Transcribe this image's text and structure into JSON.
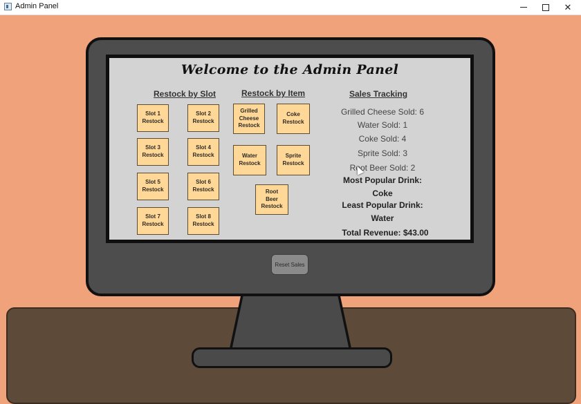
{
  "window": {
    "title": "Admin Panel",
    "controls": {
      "minimize": "minimize",
      "maximize": "maximize",
      "close": "✕"
    }
  },
  "panel": {
    "title": "Welcome to the Admin Panel",
    "restock_by_slot": {
      "heading": "Restock by Slot",
      "buttons": [
        "Slot 1\nRestock",
        "Slot 2\nRestock",
        "Slot 3\nRestock",
        "Slot 4\nRestock",
        "Slot 5\nRestock",
        "Slot 6\nRestock",
        "Slot 7\nRestock",
        "Slot 8\nRestock"
      ]
    },
    "restock_by_item": {
      "heading": "Restock by Item",
      "buttons": [
        "Grilled\nCheese\nRestock",
        "Coke\nRestock",
        "Water\nRestock",
        "Sprite\nRestock",
        "Root\nBeer\nRestock"
      ]
    },
    "sales_tracking": {
      "heading": "Sales Tracking",
      "lines": [
        "Grilled Cheese Sold: 6",
        "Water Sold: 1",
        "Coke Sold: 4",
        "Sprite Sold: 3",
        "Root Beer Sold: 2"
      ],
      "most_popular_label": "Most Popular Drink:",
      "most_popular_value": "Coke",
      "least_popular_label": "Least Popular Drink:",
      "least_popular_value": "Water",
      "total_revenue": "Total Revenue: $43.00"
    }
  },
  "reset_button": "Reset Sales",
  "colors": {
    "background": "#f0a27a",
    "monitor": "#4d4d4d",
    "screen": "#d3d3d3",
    "button": "#ffd898",
    "desk": "#5d4a39"
  }
}
